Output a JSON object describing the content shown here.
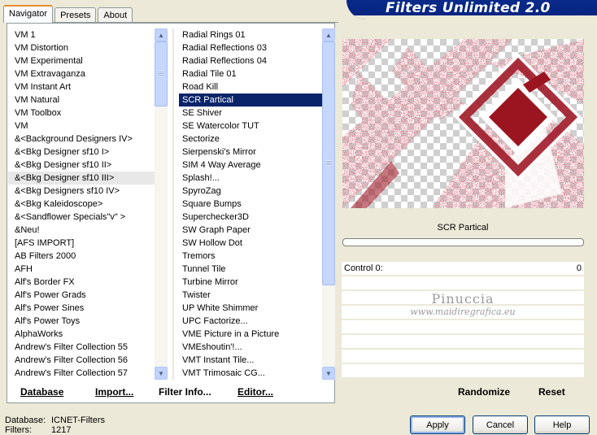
{
  "header": {
    "title": "Filters Unlimited 2.0"
  },
  "tabs": [
    {
      "label": "Navigator",
      "active": true
    },
    {
      "label": "Presets",
      "active": false
    },
    {
      "label": "About",
      "active": false
    }
  ],
  "categories": [
    "VM 1",
    "VM Distortion",
    "VM Experimental",
    "VM Extravaganza",
    "VM Instant Art",
    "VM Natural",
    "VM Toolbox",
    "VM",
    "&<Background Designers IV>",
    "&<Bkg Designer sf10 I>",
    "&<Bkg Designer sf10 II>",
    "&<Bkg Designer sf10 III>",
    "&<Bkg Designers sf10 IV>",
    "&<Bkg Kaleidoscope>",
    "&<Sandflower Specials\"v\" >",
    "&Neu!",
    "[AFS IMPORT]",
    "AB Filters 2000",
    "AFH",
    "Alf's Border FX",
    "Alf's Power Grads",
    "Alf's Power Sines",
    "Alf's Power Toys",
    "AlphaWorks",
    "Andrew's Filter Collection 55",
    "Andrew's Filter Collection 56",
    "Andrew's Filter Collection 57"
  ],
  "selected_category": "&<Bkg Designer sf10 III>",
  "filters": [
    "Radial  Rings 01",
    "Radial Reflections 03",
    "Radial Reflections 04",
    "Radial Tile 01",
    "Road Kill",
    "SCR  Partical",
    "SE Shiver",
    "SE Watercolor TUT",
    "Sectorize",
    "Sierpenski's Mirror",
    "SIM 4 Way Average",
    "Splash!...",
    "SpyroZag",
    "Square Bumps",
    "Superchecker3D",
    "SW Graph Paper",
    "SW Hollow Dot",
    "Tremors",
    "Tunnel Tile",
    "Turbine Mirror",
    "Twister",
    "UP White Shimmer",
    "UPC Factorize...",
    "VME Picture in a Picture",
    "VMEshoutin'!...",
    "VMT Instant Tile...",
    "VMT Trimosaic CG..."
  ],
  "selected_filter": "SCR  Partical",
  "left_buttons": [
    {
      "key": "D",
      "rest": "atabase"
    },
    {
      "key": "I",
      "rest": "mport..."
    },
    {
      "key": "",
      "rest": "Filter Info..."
    },
    {
      "key": "E",
      "rest": "ditor..."
    }
  ],
  "preview": {
    "filter_name": "SCR  Partical",
    "watermark_name": "Pinuccia",
    "watermark_url": "www.maidiregrafica.eu"
  },
  "controls": [
    {
      "label": "Control 0:",
      "value": "0"
    }
  ],
  "right_buttons": {
    "randomize": "Randomize",
    "reset": "Reset"
  },
  "footer": {
    "database_label": "Database:",
    "database_value": "ICNET-Filters",
    "filters_label": "Filters:",
    "filters_value": "1217"
  },
  "dialog_buttons": {
    "apply": "Apply",
    "cancel": "Cancel",
    "help": "Help"
  },
  "colors": {
    "accent_red": "#9b1520",
    "selection": "#0a246a",
    "banner": "#06237e"
  }
}
